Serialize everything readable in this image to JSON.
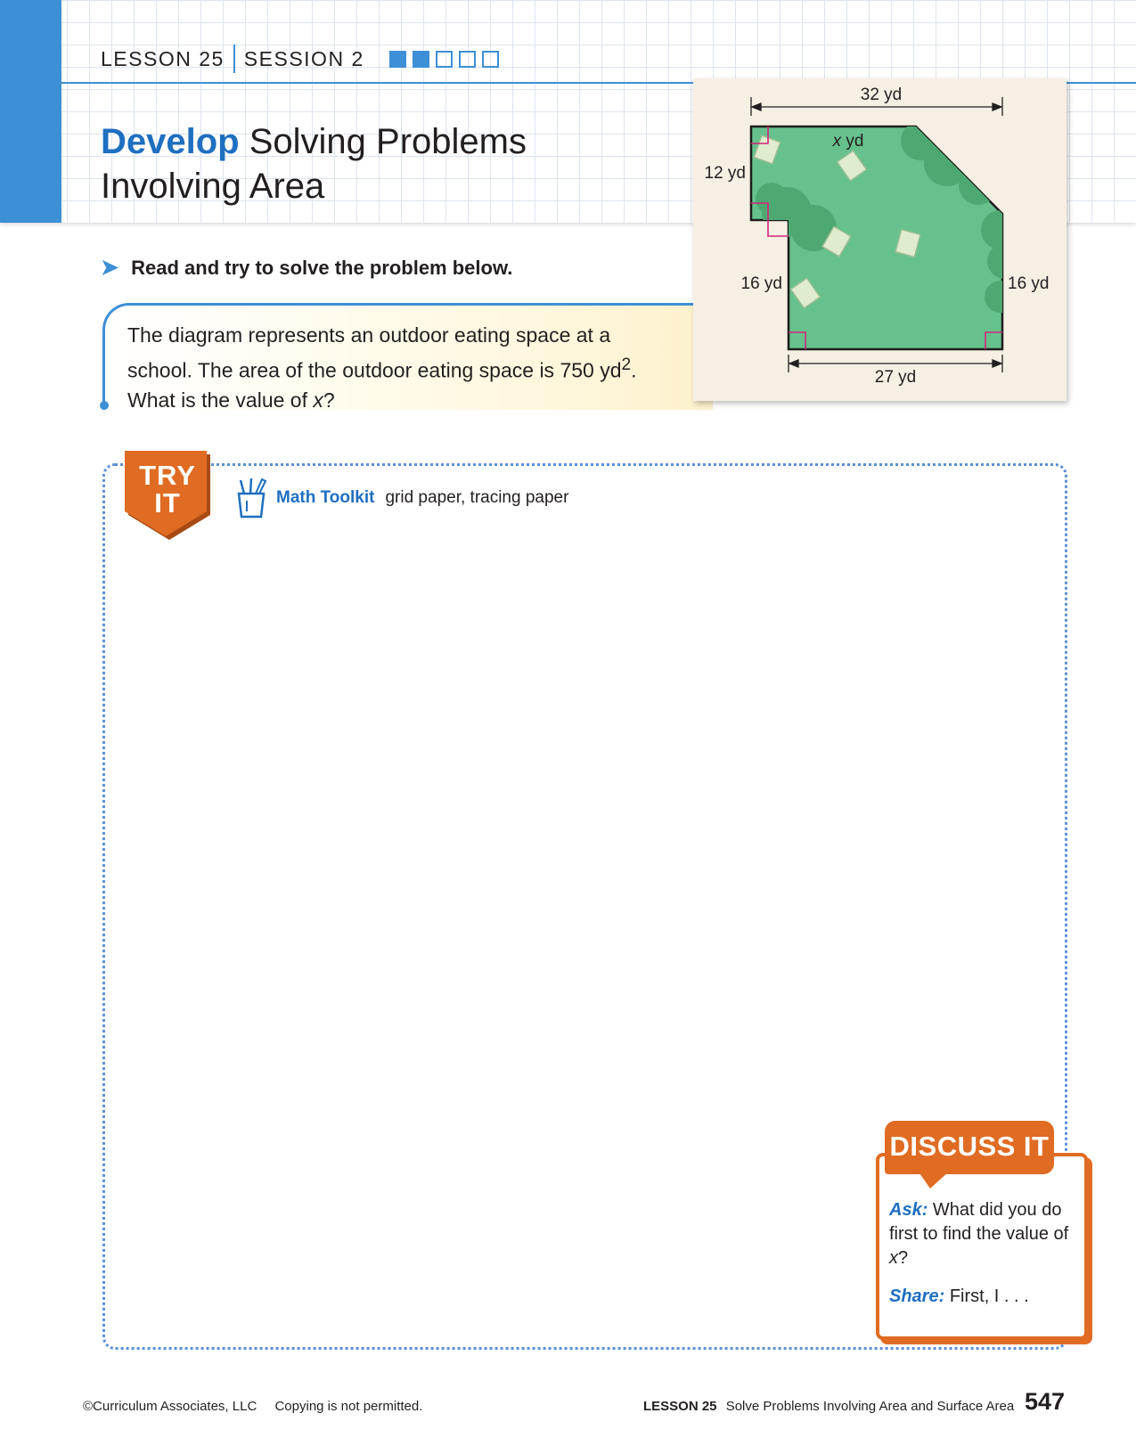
{
  "header": {
    "lesson": "LESSON 25",
    "session": "SESSION 2",
    "progress": [
      true,
      true,
      false,
      false,
      false
    ]
  },
  "title": {
    "bold": "Develop",
    "rest_line1": "Solving Problems",
    "line2": "Involving Area"
  },
  "instruction": "Read and try to solve the problem below.",
  "problem": {
    "line1": "The diagram represents an outdoor eating space at a",
    "line2_pre": "school. The area of the outdoor eating space is 750 yd",
    "line2_sup": "2",
    "line2_post": ".",
    "line3_pre": "What is the value of ",
    "line3_var": "x",
    "line3_post": "?"
  },
  "diagram": {
    "top_label": "32 yd",
    "x_var": "x",
    "x_unit": " yd",
    "left_top_label": "12 yd",
    "left_bottom_label": "16 yd",
    "right_label": "16 yd",
    "bottom_label": "27 yd",
    "fill_color": "#66c18c",
    "tree_color": "#4ea872",
    "right_angle_color": "#d0267a"
  },
  "try_it": {
    "badge_line1": "TRY",
    "badge_line2": "IT",
    "toolkit_icon": "pencil-cup-icon",
    "toolkit_label": "Math Toolkit",
    "toolkit_items": "grid paper, tracing paper"
  },
  "discuss": {
    "title": "DISCUSS IT",
    "ask_label": "Ask:",
    "ask_text_pre": "What did you do first to find the value of ",
    "ask_var": "x",
    "ask_text_post": "?",
    "share_label": "Share:",
    "share_text": "First, I . . ."
  },
  "footer": {
    "copyright": "©Curriculum Associates, LLC",
    "notice": "Copying is not permitted.",
    "lesson": "LESSON 25",
    "lesson_title": "Solve Problems Involving Area and Surface Area",
    "page": "547"
  },
  "colors": {
    "accent_blue": "#3d8fd6",
    "title_blue": "#1e6fc0",
    "orange": "#e06b22"
  }
}
